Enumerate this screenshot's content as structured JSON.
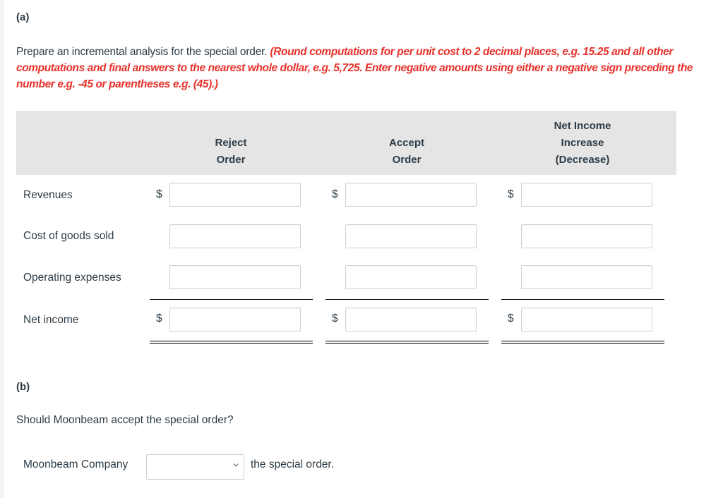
{
  "part_a": {
    "label": "(a)",
    "instruction": "Prepare an incremental analysis for the special order.",
    "note": "(Round computations for per unit cost to 2 decimal places, e.g. 15.25 and all other computations and final answers to the nearest whole dollar, e.g. 5,725. Enter negative amounts using either a negative sign preceding the number e.g. -45 or parentheses e.g. (45).)",
    "note_color": "#e8312a",
    "columns": [
      {
        "line1": "Reject",
        "line2": "Order"
      },
      {
        "line1": "Accept",
        "line2": "Order"
      },
      {
        "line1": "Net Income",
        "line2": "Increase",
        "line3": "(Decrease)"
      }
    ],
    "currency_symbol": "$",
    "rows": [
      {
        "label": "Revenues",
        "values": [
          "",
          "",
          ""
        ]
      },
      {
        "label": "Cost of goods sold",
        "values": [
          "",
          "",
          ""
        ]
      },
      {
        "label": "Operating expenses",
        "values": [
          "",
          "",
          ""
        ]
      },
      {
        "label": "Net income",
        "values": [
          "",
          "",
          ""
        ]
      }
    ]
  },
  "part_b": {
    "label": "(b)",
    "question": "Should Moonbeam accept the special order?",
    "company_label": "Moonbeam Company",
    "select_value": "",
    "after_select": "the special order."
  }
}
